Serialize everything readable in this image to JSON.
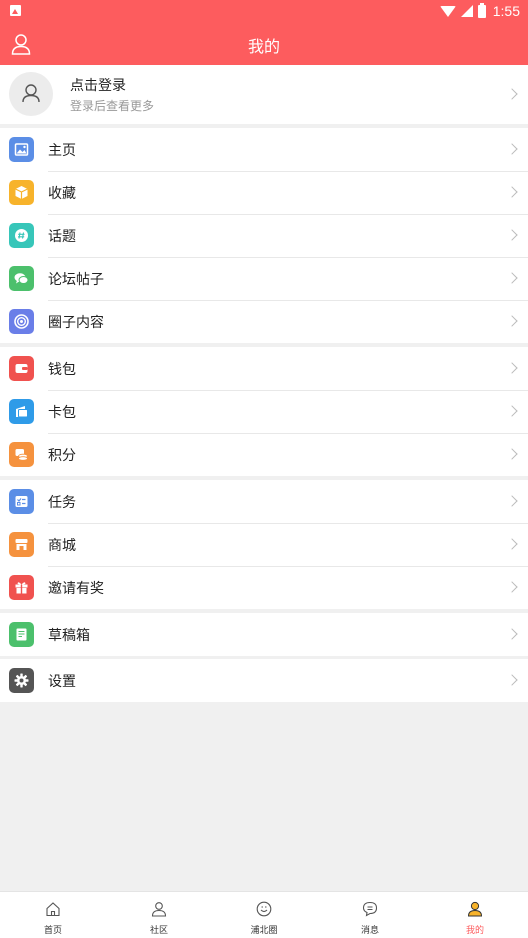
{
  "status_bar": {
    "time": "1:55"
  },
  "header": {
    "title": "我的"
  },
  "login": {
    "title": "点击登录",
    "subtitle": "登录后查看更多"
  },
  "menu_groups": [
    {
      "items": [
        {
          "label": "主页",
          "icon": "image-icon",
          "color": "#5b8ee6"
        },
        {
          "label": "收藏",
          "icon": "box-icon",
          "color": "#f7b32b"
        },
        {
          "label": "话题",
          "icon": "hash-icon",
          "color": "#37c6b9"
        },
        {
          "label": "论坛帖子",
          "icon": "chat-icon",
          "color": "#4cc06c"
        },
        {
          "label": "圈子内容",
          "icon": "target-icon",
          "color": "#6a7ee8"
        }
      ]
    },
    {
      "items": [
        {
          "label": "钱包",
          "icon": "wallet-icon",
          "color": "#f0524f"
        },
        {
          "label": "卡包",
          "icon": "card-icon",
          "color": "#2f9be8"
        },
        {
          "label": "积分",
          "icon": "coins-icon",
          "color": "#f5923e"
        }
      ]
    },
    {
      "items": [
        {
          "label": "任务",
          "icon": "task-icon",
          "color": "#5b8ee6"
        },
        {
          "label": "商城",
          "icon": "store-icon",
          "color": "#f5923e"
        },
        {
          "label": "邀请有奖",
          "icon": "gift-icon",
          "color": "#f0524f"
        }
      ]
    },
    {
      "items": [
        {
          "label": "草稿箱",
          "icon": "draft-icon",
          "color": "#4cc06c"
        }
      ]
    },
    {
      "items": [
        {
          "label": "设置",
          "icon": "gear-icon",
          "color": "#555555"
        }
      ]
    }
  ],
  "tabbar": {
    "items": [
      {
        "label": "首页",
        "icon": "home-icon"
      },
      {
        "label": "社区",
        "icon": "person-icon"
      },
      {
        "label": "浦北圈",
        "icon": "smile-circle-icon"
      },
      {
        "label": "消息",
        "icon": "message-icon"
      },
      {
        "label": "我的",
        "icon": "me-icon",
        "active": true
      }
    ]
  },
  "colors": {
    "brand": "#fd5c5e",
    "page_bg": "#f0f0f0",
    "divider": "#e8e8e8"
  }
}
